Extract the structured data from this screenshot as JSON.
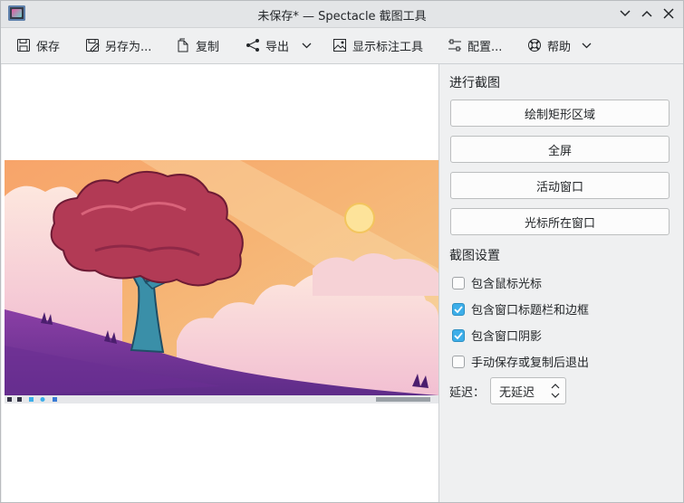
{
  "window": {
    "title": "未保存* — Spectacle 截图工具"
  },
  "toolbar": {
    "save": "保存",
    "save_as": "另存为...",
    "copy": "复制",
    "export": "导出",
    "annotate": "显示标注工具",
    "configure": "配置...",
    "help": "帮助"
  },
  "capture": {
    "heading": "进行截图",
    "rect_region": "绘制矩形区域",
    "fullscreen": "全屏",
    "active_window": "活动窗口",
    "window_under_cursor": "光标所在窗口"
  },
  "settings": {
    "heading": "截图设置",
    "options": [
      {
        "label": "包含鼠标光标",
        "checked": false
      },
      {
        "label": "包含窗口标题栏和边框",
        "checked": true
      },
      {
        "label": "包含窗口阴影",
        "checked": true
      },
      {
        "label": "手动保存或复制后退出",
        "checked": false
      }
    ],
    "delay_label": "延迟：",
    "delay_value": "无延迟"
  },
  "colors": {
    "accent": "#3daee9",
    "window_bg": "#eff0f1"
  }
}
